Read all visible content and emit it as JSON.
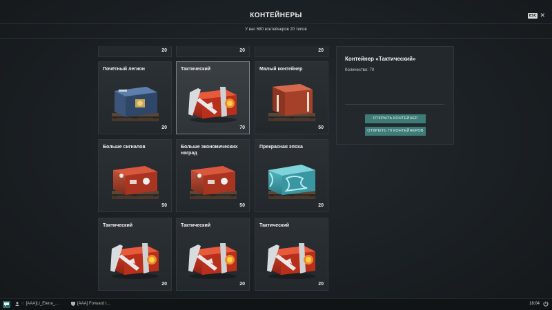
{
  "header": {
    "title": "КОНТЕЙНЕРЫ",
    "subtitle": "У вас 680 контейнеров 20 типов",
    "esc_label": "ESC"
  },
  "grid": {
    "top_partial_counts": [
      "20",
      "20",
      "20"
    ],
    "cards": [
      {
        "name": "Почётный легион",
        "count": "20",
        "art": "container-legion-icon"
      },
      {
        "name": "Тактический",
        "count": "70",
        "art": "container-tactical-icon",
        "selected": true
      },
      {
        "name": "Малый контейнер",
        "count": "50",
        "art": "container-small-icon"
      },
      {
        "name": "Больше сигналов",
        "count": "50",
        "art": "container-signals-icon"
      },
      {
        "name": "Больше экономических наград",
        "count": "50",
        "art": "container-economic-icon"
      },
      {
        "name": "Прекрасная эпоха",
        "count": "20",
        "art": "container-belle-epoque-icon"
      },
      {
        "name": "Тактический",
        "count": "20",
        "art": "container-tactical-icon"
      },
      {
        "name": "Тактический",
        "count": "20",
        "art": "container-tactical-icon"
      },
      {
        "name": "Тактический",
        "count": "20",
        "art": "container-tactical-icon"
      }
    ]
  },
  "details": {
    "title": "Контейнер «Тактический»",
    "quantity": "Количество: 70",
    "open_one": "ОТКРЫТЬ КОНТЕЙНЕР",
    "open_all": "ОТКРЫТЬ 70 КОНТЕЙНЕРОВ"
  },
  "statusbar": {
    "user": "[AAA]Lt_Elena_...",
    "clan": "[AAA] Forward t...",
    "time": "18:04"
  },
  "colors": {
    "accent": "#3e7c78",
    "background": "#1b2024",
    "card": "#2b3035",
    "tactical_red": "#c8321f",
    "legion_blue": "#3a5680",
    "belle_teal": "#45a9b4"
  }
}
